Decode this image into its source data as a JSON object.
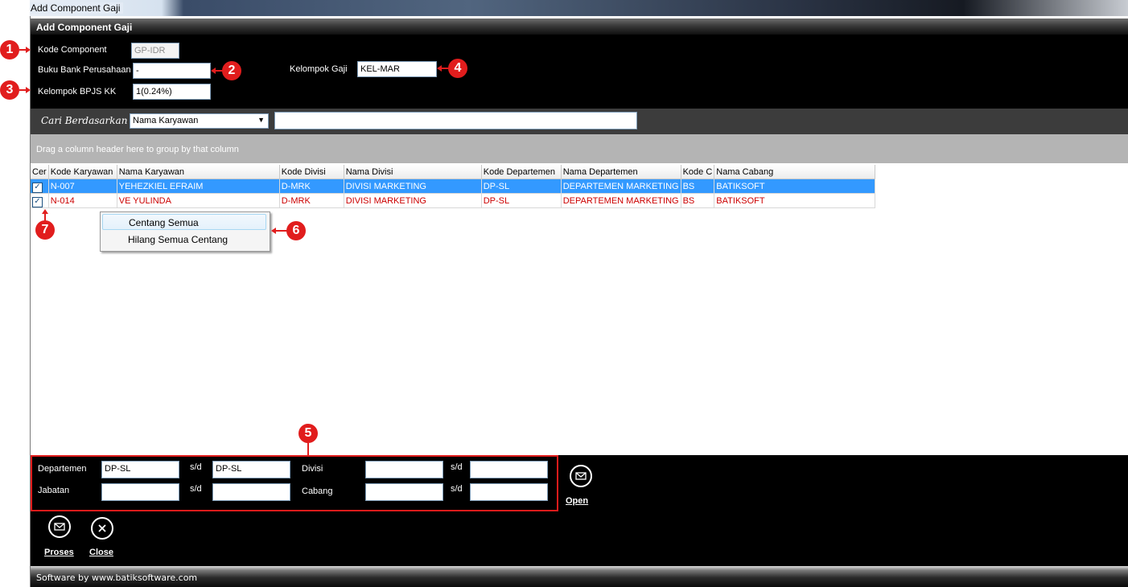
{
  "window": {
    "title": "Add Component Gaji",
    "header": "Add Component Gaji"
  },
  "form": {
    "kode_component_label": "Kode Component",
    "kode_component_value": "GP-IDR",
    "buku_bank_label": "Buku Bank Perusahaan",
    "buku_bank_value": "-",
    "kelompok_gaji_label": "Kelompok Gaji",
    "kelompok_gaji_value": "KEL-MAR",
    "kelompok_bpjs_label": "Kelompok BPJS KK",
    "kelompok_bpjs_value": "1(0.24%)"
  },
  "search": {
    "label": "Cari Berdasarkan",
    "selected": "Nama Karyawan",
    "value": ""
  },
  "group_hint": "Drag a column header here to group by that column",
  "grid": {
    "columns": [
      "Cer",
      "Kode Karyawan",
      "Nama Karyawan",
      "Kode Divisi",
      "Nama Divisi",
      "Kode Departemen",
      "Nama Departemen",
      "Kode C",
      "Nama Cabang"
    ],
    "rows": [
      [
        "N-007",
        "YEHEZKIEL EFRAIM",
        "D-MRK",
        "DIVISI MARKETING",
        "DP-SL",
        "DEPARTEMEN MARKETING",
        "BS",
        "BATIKSOFT"
      ],
      [
        "N-014",
        "VE YULINDA",
        "D-MRK",
        "DIVISI MARKETING",
        "DP-SL",
        "DEPARTEMEN MARKETING",
        "BS",
        "BATIKSOFT"
      ]
    ]
  },
  "context_menu": {
    "items": [
      "Centang Semua",
      "Hilang Semua Centang"
    ]
  },
  "filter": {
    "departemen_label": "Departemen",
    "departemen_from": "DP-SL",
    "departemen_to": "DP-SL",
    "jabatan_label": "Jabatan",
    "jabatan_from": "",
    "jabatan_to": "",
    "divisi_label": "Divisi",
    "divisi_from": "",
    "divisi_to": "",
    "cabang_label": "Cabang",
    "cabang_from": "",
    "cabang_to": "",
    "sd": "s/d"
  },
  "buttons": {
    "open": "Open",
    "proses": "Proses",
    "close": "Close"
  },
  "footer": "Software by www.batiksoftware.com",
  "callouts": [
    "1",
    "2",
    "3",
    "4",
    "5",
    "6",
    "7"
  ],
  "colors": {
    "callout": "#e11d1d",
    "selected_row": "#3399ff",
    "red_row_text": "#cc0000"
  }
}
